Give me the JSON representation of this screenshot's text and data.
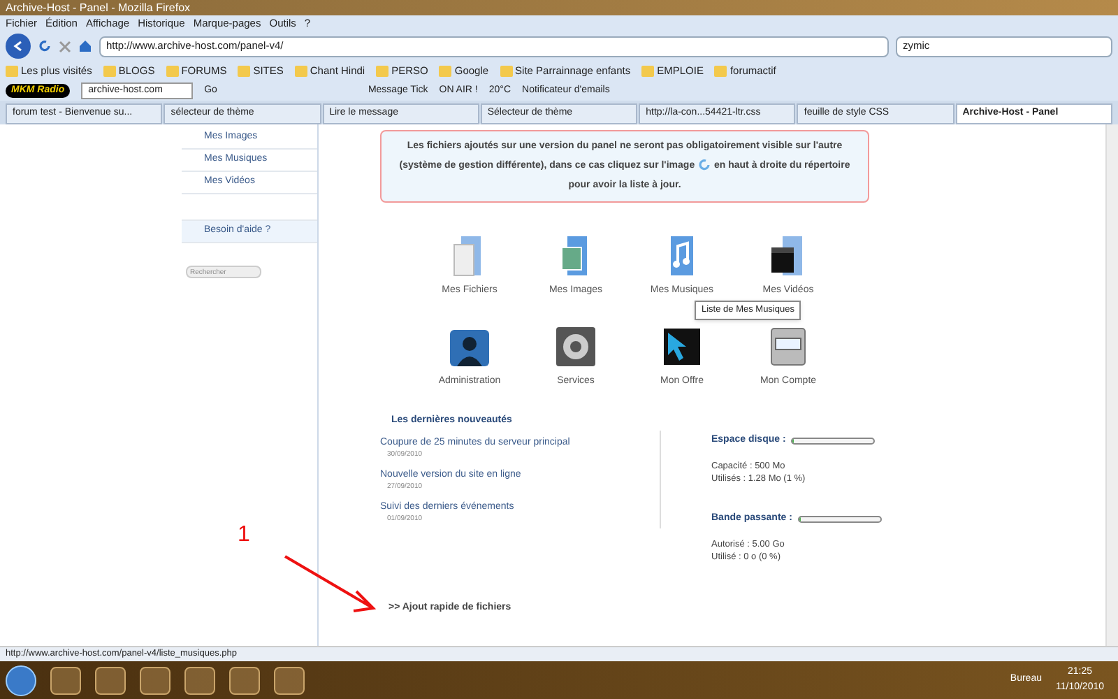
{
  "window": {
    "title": "Archive-Host - Panel - Mozilla Firefox"
  },
  "menu": [
    "Fichier",
    "Édition",
    "Affichage",
    "Historique",
    "Marque-pages",
    "Outils",
    "?"
  ],
  "nav": {
    "url": "http://www.archive-host.com/panel-v4/",
    "search": "zymic"
  },
  "bookmarks": [
    "Les plus visités",
    "BLOGS",
    "FORUMS",
    "SITES",
    "Chant Hindi",
    "PERSO",
    "Google",
    "Site Parrainnage enfants",
    "EMPLOIE",
    "forumactif"
  ],
  "toolbar": {
    "logo": "MKM Radio",
    "site": "archive-host.com",
    "go": "Go",
    "message": "Message Tick",
    "onair": "ON AIR !",
    "weather": "20°C",
    "mail": "Notificateur d'emails"
  },
  "tabs": [
    {
      "label": "forum test - Bienvenue su...",
      "selected": false
    },
    {
      "label": "sélecteur de thème",
      "selected": false
    },
    {
      "label": "Lire le message",
      "selected": false
    },
    {
      "label": "Sélecteur de thème",
      "selected": false
    },
    {
      "label": "http://la-con...54421-ltr.css",
      "selected": false
    },
    {
      "label": "feuille de style CSS",
      "selected": false
    },
    {
      "label": "Archive-Host - Panel",
      "selected": true
    }
  ],
  "sidebar": {
    "items": [
      "Mes Images",
      "Mes Musiques",
      "Mes Vidéos"
    ],
    "help": "Besoin d'aide ?",
    "search_placeholder": "Rechercher"
  },
  "notice": {
    "before": "Les fichiers ajoutés sur une version du panel ne seront pas obligatoirement visible sur l'autre (système de gestion différente), dans ce cas cliquez sur l'image",
    "after": "en haut à droite du répertoire pour avoir la liste à jour."
  },
  "apps": [
    {
      "label": "Mes Fichiers",
      "kind": "files"
    },
    {
      "label": "Mes Images",
      "kind": "images"
    },
    {
      "label": "Mes Musiques",
      "kind": "music"
    },
    {
      "label": "Mes Vidéos",
      "kind": "videos"
    },
    {
      "label": "Administration",
      "kind": "admin"
    },
    {
      "label": "Services",
      "kind": "services"
    },
    {
      "label": "Mon Offre",
      "kind": "offer"
    },
    {
      "label": "Mon Compte",
      "kind": "account"
    }
  ],
  "tooltip": "Liste de Mes Musiques",
  "news": {
    "title": "Les dernières nouveautés",
    "items": [
      {
        "title": "Coupure de 25 minutes du serveur principal",
        "date": "30/09/2010"
      },
      {
        "title": "Nouvelle version du site en ligne",
        "date": "27/09/2010"
      },
      {
        "title": "Suivi des derniers événements",
        "date": "01/09/2010"
      }
    ]
  },
  "quotas": [
    {
      "label": "Espace disque :",
      "level": 0.02,
      "lines": [
        "Capacité : 500 Mo",
        "Utilisés : 1.28 Mo (1 %)"
      ]
    },
    {
      "label": "Bande passante :",
      "level": 0,
      "lines": [
        "Autorisé : 5.00 Go",
        "Utilisé : 0 o (0 %)"
      ]
    }
  ],
  "quick_add": ">> Ajout rapide de fichiers",
  "annotation": "1",
  "status_bar": "http://www.archive-host.com/panel-v4/liste_musiques.php",
  "taskbar": {
    "desktop": "Bureau",
    "time": "21:25",
    "date": "11/10/2010"
  }
}
